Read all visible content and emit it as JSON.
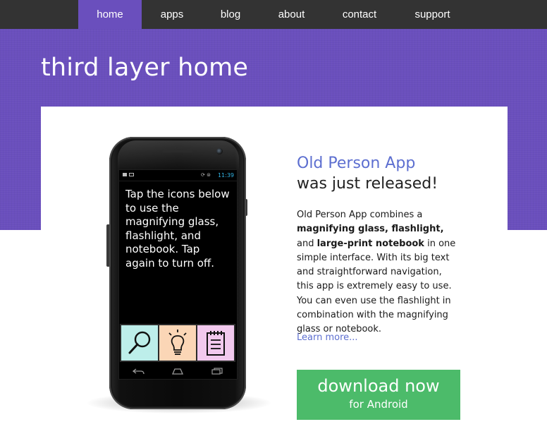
{
  "nav": {
    "items": [
      {
        "label": "home",
        "active": true
      },
      {
        "label": "apps",
        "active": false
      },
      {
        "label": "blog",
        "active": false
      },
      {
        "label": "about",
        "active": false
      },
      {
        "label": "contact",
        "active": false
      },
      {
        "label": "support",
        "active": false
      }
    ]
  },
  "hero": {
    "title": "third layer home"
  },
  "phone": {
    "status_time": "11:39",
    "status_icons": "⟳ ⊜",
    "screen_text": "Tap the icons below to use the magnifying glass, flashlight, and notebook. Tap again to turn off.",
    "app_buttons": [
      {
        "icon": "magnifying-glass-icon",
        "color": "#bdeeea"
      },
      {
        "icon": "lightbulb-icon",
        "color": "#fbd6b6"
      },
      {
        "icon": "notebook-icon",
        "color": "#f2c9ee"
      }
    ],
    "navkeys": [
      "back-icon",
      "home-icon",
      "recent-apps-icon"
    ]
  },
  "promo": {
    "headline_app": "Old Person App",
    "headline_rest": "was just released!",
    "desc_1": "Old Person App combines a ",
    "desc_bold_1": "magnifying glass, flashlight,",
    "desc_2": " and ",
    "desc_bold_2": "large-print notebook",
    "desc_3": " in one simple interface. With its big text and straightforward navigation, this app is extremely easy to use. You can even use the flashlight in combination with the magnifying glass or notebook.",
    "learn_more": "Learn more...",
    "download_main": "download now",
    "download_sub": "for Android"
  },
  "colors": {
    "nav_bg": "#333333",
    "accent_purple": "#6a4fbd",
    "link_blue": "#5d6fd0",
    "download_green": "#4cbb6a"
  }
}
